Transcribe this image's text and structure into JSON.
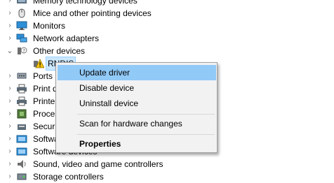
{
  "tree": {
    "items": [
      {
        "label": "Memory technology devices",
        "icon": "memory-chip-icon",
        "chevron": "›"
      },
      {
        "label": "Mice and other pointing devices",
        "icon": "mouse-icon",
        "chevron": "›"
      },
      {
        "label": "Monitors",
        "icon": "monitor-icon",
        "chevron": "›"
      },
      {
        "label": "Network adapters",
        "icon": "network-adapter-icon",
        "chevron": "›"
      },
      {
        "label": "Other devices",
        "icon": "unknown-device-icon",
        "chevron": "⌄"
      },
      {
        "label": "RNDIS",
        "icon": "warning-device-icon",
        "chevron": ""
      },
      {
        "label": "Ports (COM & LPT)",
        "icon": "port-icon",
        "chevron": "›"
      },
      {
        "label": "Print queues",
        "icon": "printer-icon",
        "chevron": "›"
      },
      {
        "label": "Printers",
        "icon": "printer-icon",
        "chevron": "›"
      },
      {
        "label": "Processors",
        "icon": "processor-icon",
        "chevron": "›"
      },
      {
        "label": "Security devices",
        "icon": "security-icon",
        "chevron": "›"
      },
      {
        "label": "Software components",
        "icon": "software-icon",
        "chevron": "›"
      },
      {
        "label": "Software devices",
        "icon": "software-icon",
        "chevron": "›"
      },
      {
        "label": "Sound, video and game controllers",
        "icon": "speaker-icon",
        "chevron": "›"
      },
      {
        "label": "Storage controllers",
        "icon": "storage-icon",
        "chevron": "›"
      }
    ]
  },
  "context_menu": {
    "update_driver": "Update driver",
    "disable_device": "Disable device",
    "uninstall_device": "Uninstall device",
    "scan_hardware": "Scan for hardware changes",
    "properties": "Properties"
  },
  "colors": {
    "menu_bg": "#f2f2f2",
    "menu_highlight": "#91c9f7",
    "selection": "#cce8ff"
  }
}
